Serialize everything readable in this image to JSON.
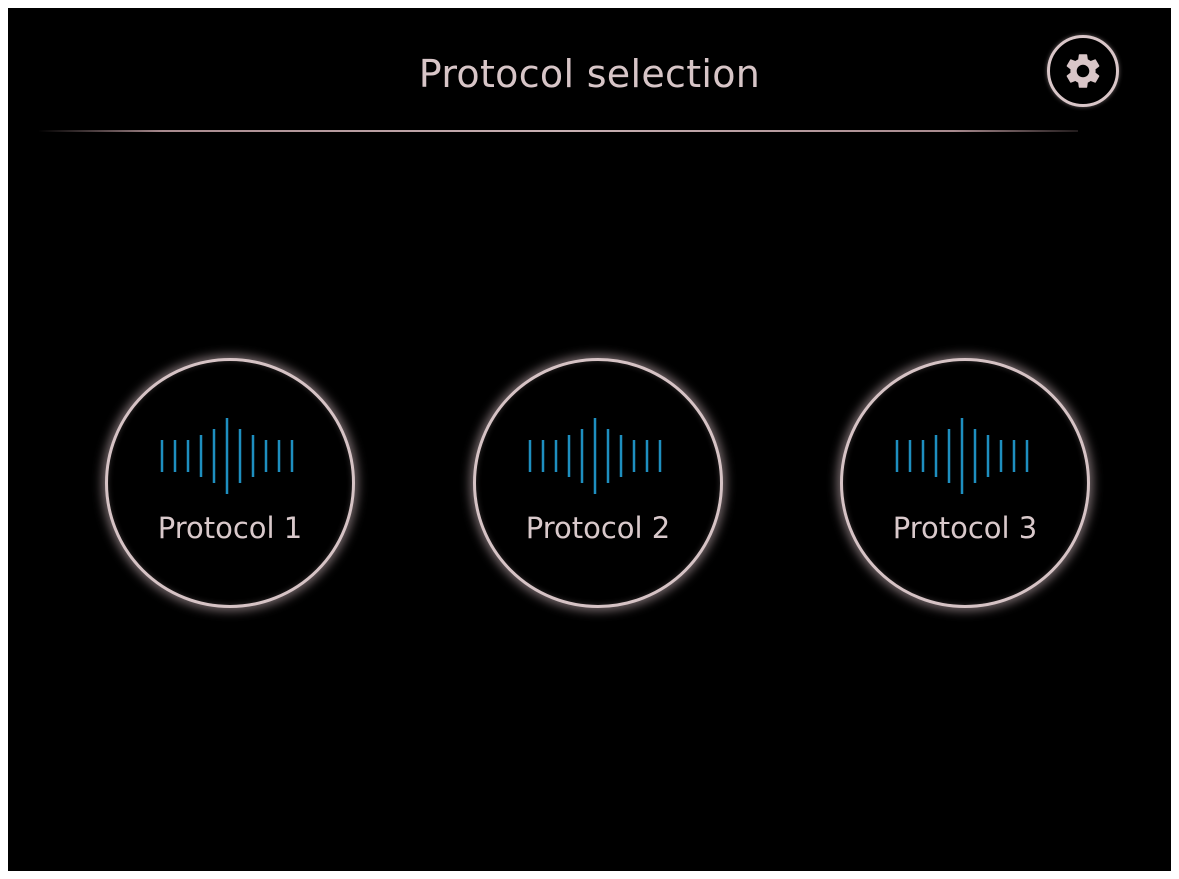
{
  "header": {
    "title": "Protocol selection",
    "settings_icon": "gear-icon"
  },
  "protocols": [
    {
      "label": "Protocol 1",
      "icon": "waveform-icon"
    },
    {
      "label": "Protocol 2",
      "icon": "waveform-icon"
    },
    {
      "label": "Protocol 3",
      "icon": "waveform-icon"
    }
  ],
  "colors": {
    "background": "#000000",
    "accent_ring": "#d6c3c5",
    "waveform": "#1e8fc0",
    "text": "#d9c9cb"
  }
}
